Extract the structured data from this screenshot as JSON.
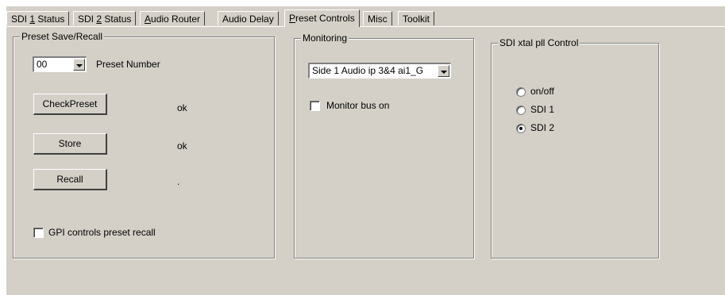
{
  "tabs": [
    {
      "pre": "SDI ",
      "u": "1",
      "post": " Status"
    },
    {
      "pre": "SDI ",
      "u": "2",
      "post": " Status"
    },
    {
      "pre": "",
      "u": "A",
      "post": "udio Router"
    },
    {
      "pre": "Audio Delay",
      "u": "",
      "post": ""
    },
    {
      "pre": "",
      "u": "P",
      "post": "reset Controls"
    },
    {
      "pre": "Misc",
      "u": "",
      "post": ""
    },
    {
      "pre": "Toolkit",
      "u": "",
      "post": ""
    }
  ],
  "preset": {
    "title": "Preset Save/Recall",
    "number_value": "00",
    "number_label": "Preset Number",
    "check_label": "CheckPreset",
    "check_status": "ok",
    "store_label": "Store",
    "store_status": "ok",
    "recall_label": "Recall",
    "recall_status": ".",
    "gpi_label": "GPI controls preset recall",
    "gpi_checked": false
  },
  "monitoring": {
    "title": "Monitoring",
    "source_value": "Side 1 Audio ip  3&4  ai1_G",
    "bus_label": "Monitor bus on",
    "bus_checked": false
  },
  "xtal": {
    "title": "SDI xtal pll Control",
    "options": [
      "on/off",
      "SDI 1",
      "SDI 2"
    ],
    "selected_index": 2
  }
}
